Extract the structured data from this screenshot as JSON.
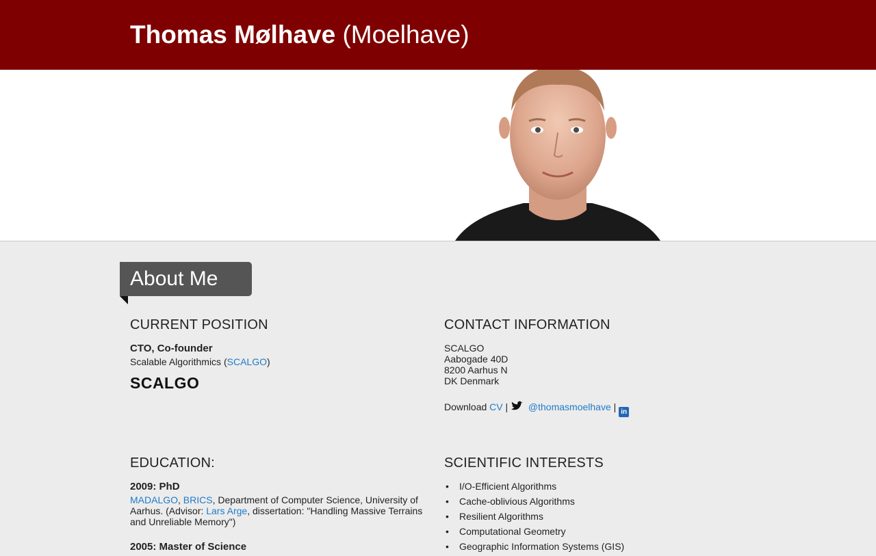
{
  "header": {
    "name_bold": "Thomas Mølhave",
    "name_alt": "(Moelhave)"
  },
  "about": {
    "tab_label": "About Me"
  },
  "current_position": {
    "heading": "CURRENT POSITION",
    "role": "CTO, Co-founder",
    "org_prefix": "Scalable Algorithmics (",
    "org_link": "SCALGO",
    "org_suffix": ")",
    "logo_text": "SCALGO"
  },
  "contact": {
    "heading": "CONTACT INFORMATION",
    "lines": [
      "SCALGO",
      "Aabogade 40D",
      "8200 Aarhus N",
      "DK Denmark"
    ],
    "download_label": "Download",
    "cv_link": "CV",
    "separator": "|",
    "twitter_handle": "@thomasmoelhave",
    "linkedin_glyph": "in"
  },
  "education": {
    "heading": "EDUCATION:",
    "entries": [
      {
        "title": "2009: PhD",
        "link1": "MADALGO",
        "comma": ",",
        "link2": "BRICS",
        "text1": ", Department of Computer Science, University of Aarhus. (Advisor:",
        "advisor": "Lars Arge",
        "text2": ", dissertation: \"Handling Massive Terrains and Unreliable Memory\")"
      },
      {
        "title": "2005: Master of Science"
      }
    ]
  },
  "interests": {
    "heading": "SCIENTIFIC INTERESTS",
    "items": [
      "I/O-Efficient Algorithms",
      "Cache-oblivious Algorithms",
      "Resilient Algorithms",
      "Computational Geometry",
      "Geographic Information Systems (GIS)"
    ]
  },
  "colors": {
    "header_bg": "#7f0000",
    "link": "#1e7bc8",
    "tab_bg": "#555555",
    "page_bg": "#ececec"
  }
}
